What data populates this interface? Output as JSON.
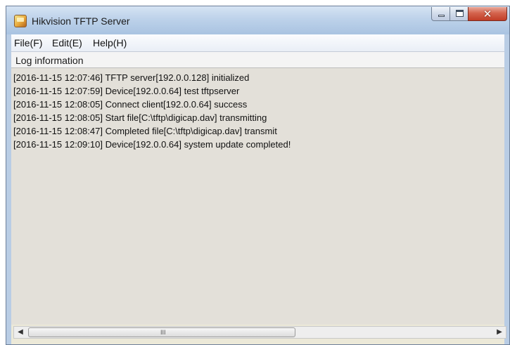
{
  "window": {
    "title": "Hikvision TFTP Server",
    "close_glyph": "✕"
  },
  "menu": {
    "items": [
      {
        "label": "File(F)"
      },
      {
        "label": "Edit(E)"
      },
      {
        "label": "Help(H)"
      }
    ]
  },
  "log": {
    "header": "Log information",
    "lines": [
      "[2016-11-15 12:07:46] TFTP server[192.0.0.128] initialized",
      "[2016-11-15 12:07:59] Device[192.0.0.64] test tftpserver",
      "[2016-11-15 12:08:05] Connect client[192.0.0.64] success",
      "[2016-11-15 12:08:05] Start file[C:\\tftp\\digicap.dav] transmitting",
      "[2016-11-15 12:08:47] Completed file[C:\\tftp\\digicap.dav] transmit",
      "[2016-11-15 12:09:10] Device[192.0.0.64] system update completed!"
    ]
  },
  "scrollbar": {
    "left_arrow": "◀",
    "right_arrow": "▶",
    "grip": "III"
  },
  "colors": {
    "titlebar": "#bdd2ea",
    "close_button": "#c13d26",
    "log_background": "#e3e0d9"
  }
}
